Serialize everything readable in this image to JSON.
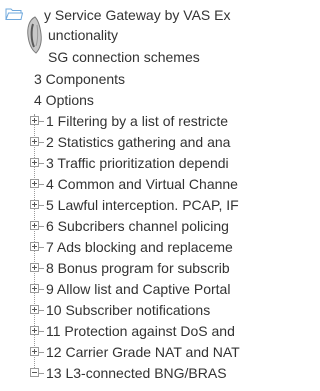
{
  "tree": {
    "root_partial": [
      "y Service Gateway by VAS Ex",
      "unctionality",
      "SG connection schemes",
      "3 Components",
      "4 Options"
    ],
    "children": [
      {
        "label": "1 Filtering by a list of restricte",
        "expander": "+"
      },
      {
        "label": "2 Statistics gathering and ana",
        "expander": "+"
      },
      {
        "label": "3 Traffic prioritization dependi",
        "expander": "+"
      },
      {
        "label": "4 Common and Virtual Channe",
        "expander": "+"
      },
      {
        "label": "5 Lawful interception. PCAP, IF",
        "expander": "+"
      },
      {
        "label": "6 Subcribers channel policing",
        "expander": "+"
      },
      {
        "label": "7 Ads blocking and replaceme",
        "expander": "+"
      },
      {
        "label": "8 Bonus program for subscrib",
        "expander": "+"
      },
      {
        "label": "9 Allow list and Captive Portal",
        "expander": "+"
      },
      {
        "label": "10 Subscriber notifications",
        "expander": "+"
      },
      {
        "label": "11 Protection against DoS and",
        "expander": "+"
      },
      {
        "label": "12 Carrier Grade NAT and NAT",
        "expander": "+"
      },
      {
        "label": "13 L3-connected BNG/BRAS",
        "expander": "−"
      }
    ]
  },
  "colors": {
    "text": "#333333",
    "tree_line": "#9a9a9a",
    "folder": "#6fa8dc"
  },
  "icons": {
    "folder": "folder-open-icon",
    "overlay": "drag-cursor-icon",
    "expand": "plus-square-icon",
    "collapse": "minus-square-icon"
  }
}
